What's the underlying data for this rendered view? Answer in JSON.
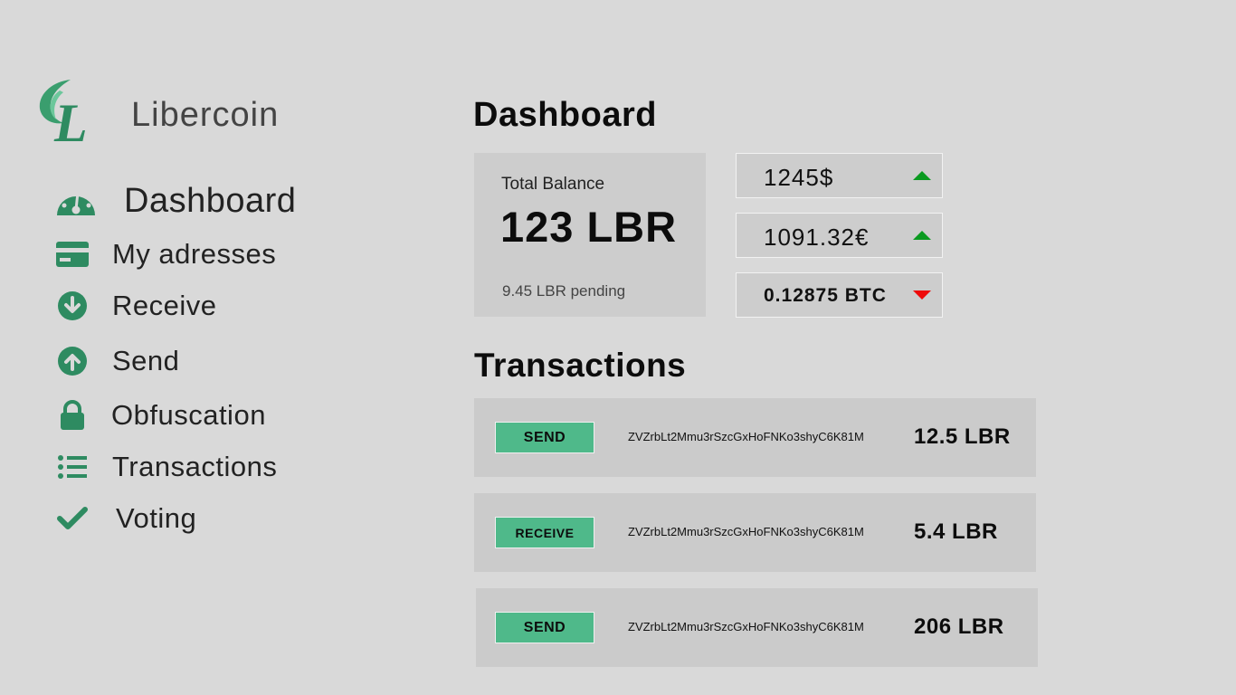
{
  "app": {
    "brand": "Libercoin",
    "accent_color": "#2e8b61",
    "logo_letters": "GL"
  },
  "sidebar": {
    "items": [
      {
        "label": "Dashboard",
        "icon": "gauge-icon"
      },
      {
        "label": "My adresses",
        "icon": "card-icon"
      },
      {
        "label": "Receive",
        "icon": "arrow-down-circle-icon"
      },
      {
        "label": "Send",
        "icon": "arrow-up-circle-icon"
      },
      {
        "label": "Obfuscation",
        "icon": "lock-icon"
      },
      {
        "label": "Transactions",
        "icon": "list-icon"
      },
      {
        "label": "Voting",
        "icon": "check-icon"
      }
    ]
  },
  "main": {
    "title": "Dashboard",
    "balance": {
      "label": "Total Balance",
      "value": "123 LBR",
      "pending": "9.45 LBR pending"
    },
    "rates": [
      {
        "value": "1245$",
        "trend": "up",
        "trend_color": "#0a9a20"
      },
      {
        "value": "1091.32€",
        "trend": "up",
        "trend_color": "#0a9a20"
      },
      {
        "value": "0.12875 BTC",
        "trend": "down",
        "trend_color": "#ee0a0a"
      }
    ],
    "transactions_title": "Transactions",
    "transactions": [
      {
        "type": "SEND",
        "address": "ZVZrbLt2Mmu3rSzcGxHoFNKo3shyC6K81M",
        "amount": "12.5 LBR"
      },
      {
        "type": "RECEIVE",
        "address": "ZVZrbLt2Mmu3rSzcGxHoFNKo3shyC6K81M",
        "amount": "5.4 LBR"
      },
      {
        "type": "SEND",
        "address": "ZVZrbLt2Mmu3rSzcGxHoFNKo3shyC6K81M",
        "amount": "206 LBR"
      }
    ]
  }
}
